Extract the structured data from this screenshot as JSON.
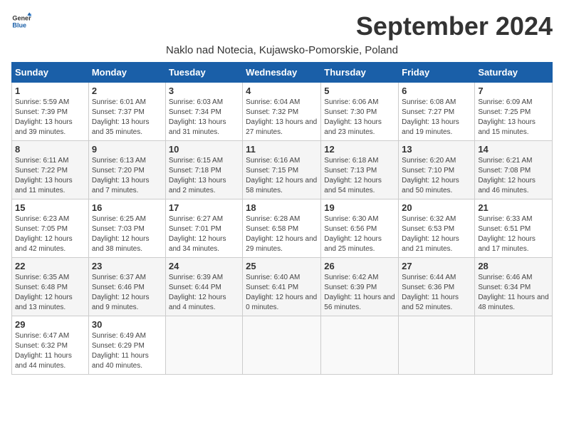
{
  "header": {
    "logo_general": "General",
    "logo_blue": "Blue",
    "month_title": "September 2024",
    "subtitle": "Naklo nad Notecia, Kujawsko-Pomorskie, Poland"
  },
  "days_of_week": [
    "Sunday",
    "Monday",
    "Tuesday",
    "Wednesday",
    "Thursday",
    "Friday",
    "Saturday"
  ],
  "weeks": [
    [
      {
        "day": "1",
        "info": "Sunrise: 5:59 AM\nSunset: 7:39 PM\nDaylight: 13 hours and 39 minutes."
      },
      {
        "day": "2",
        "info": "Sunrise: 6:01 AM\nSunset: 7:37 PM\nDaylight: 13 hours and 35 minutes."
      },
      {
        "day": "3",
        "info": "Sunrise: 6:03 AM\nSunset: 7:34 PM\nDaylight: 13 hours and 31 minutes."
      },
      {
        "day": "4",
        "info": "Sunrise: 6:04 AM\nSunset: 7:32 PM\nDaylight: 13 hours and 27 minutes."
      },
      {
        "day": "5",
        "info": "Sunrise: 6:06 AM\nSunset: 7:30 PM\nDaylight: 13 hours and 23 minutes."
      },
      {
        "day": "6",
        "info": "Sunrise: 6:08 AM\nSunset: 7:27 PM\nDaylight: 13 hours and 19 minutes."
      },
      {
        "day": "7",
        "info": "Sunrise: 6:09 AM\nSunset: 7:25 PM\nDaylight: 13 hours and 15 minutes."
      }
    ],
    [
      {
        "day": "8",
        "info": "Sunrise: 6:11 AM\nSunset: 7:22 PM\nDaylight: 13 hours and 11 minutes."
      },
      {
        "day": "9",
        "info": "Sunrise: 6:13 AM\nSunset: 7:20 PM\nDaylight: 13 hours and 7 minutes."
      },
      {
        "day": "10",
        "info": "Sunrise: 6:15 AM\nSunset: 7:18 PM\nDaylight: 13 hours and 2 minutes."
      },
      {
        "day": "11",
        "info": "Sunrise: 6:16 AM\nSunset: 7:15 PM\nDaylight: 12 hours and 58 minutes."
      },
      {
        "day": "12",
        "info": "Sunrise: 6:18 AM\nSunset: 7:13 PM\nDaylight: 12 hours and 54 minutes."
      },
      {
        "day": "13",
        "info": "Sunrise: 6:20 AM\nSunset: 7:10 PM\nDaylight: 12 hours and 50 minutes."
      },
      {
        "day": "14",
        "info": "Sunrise: 6:21 AM\nSunset: 7:08 PM\nDaylight: 12 hours and 46 minutes."
      }
    ],
    [
      {
        "day": "15",
        "info": "Sunrise: 6:23 AM\nSunset: 7:05 PM\nDaylight: 12 hours and 42 minutes."
      },
      {
        "day": "16",
        "info": "Sunrise: 6:25 AM\nSunset: 7:03 PM\nDaylight: 12 hours and 38 minutes."
      },
      {
        "day": "17",
        "info": "Sunrise: 6:27 AM\nSunset: 7:01 PM\nDaylight: 12 hours and 34 minutes."
      },
      {
        "day": "18",
        "info": "Sunrise: 6:28 AM\nSunset: 6:58 PM\nDaylight: 12 hours and 29 minutes."
      },
      {
        "day": "19",
        "info": "Sunrise: 6:30 AM\nSunset: 6:56 PM\nDaylight: 12 hours and 25 minutes."
      },
      {
        "day": "20",
        "info": "Sunrise: 6:32 AM\nSunset: 6:53 PM\nDaylight: 12 hours and 21 minutes."
      },
      {
        "day": "21",
        "info": "Sunrise: 6:33 AM\nSunset: 6:51 PM\nDaylight: 12 hours and 17 minutes."
      }
    ],
    [
      {
        "day": "22",
        "info": "Sunrise: 6:35 AM\nSunset: 6:48 PM\nDaylight: 12 hours and 13 minutes."
      },
      {
        "day": "23",
        "info": "Sunrise: 6:37 AM\nSunset: 6:46 PM\nDaylight: 12 hours and 9 minutes."
      },
      {
        "day": "24",
        "info": "Sunrise: 6:39 AM\nSunset: 6:44 PM\nDaylight: 12 hours and 4 minutes."
      },
      {
        "day": "25",
        "info": "Sunrise: 6:40 AM\nSunset: 6:41 PM\nDaylight: 12 hours and 0 minutes."
      },
      {
        "day": "26",
        "info": "Sunrise: 6:42 AM\nSunset: 6:39 PM\nDaylight: 11 hours and 56 minutes."
      },
      {
        "day": "27",
        "info": "Sunrise: 6:44 AM\nSunset: 6:36 PM\nDaylight: 11 hours and 52 minutes."
      },
      {
        "day": "28",
        "info": "Sunrise: 6:46 AM\nSunset: 6:34 PM\nDaylight: 11 hours and 48 minutes."
      }
    ],
    [
      {
        "day": "29",
        "info": "Sunrise: 6:47 AM\nSunset: 6:32 PM\nDaylight: 11 hours and 44 minutes."
      },
      {
        "day": "30",
        "info": "Sunrise: 6:49 AM\nSunset: 6:29 PM\nDaylight: 11 hours and 40 minutes."
      },
      {
        "day": "",
        "info": ""
      },
      {
        "day": "",
        "info": ""
      },
      {
        "day": "",
        "info": ""
      },
      {
        "day": "",
        "info": ""
      },
      {
        "day": "",
        "info": ""
      }
    ]
  ]
}
